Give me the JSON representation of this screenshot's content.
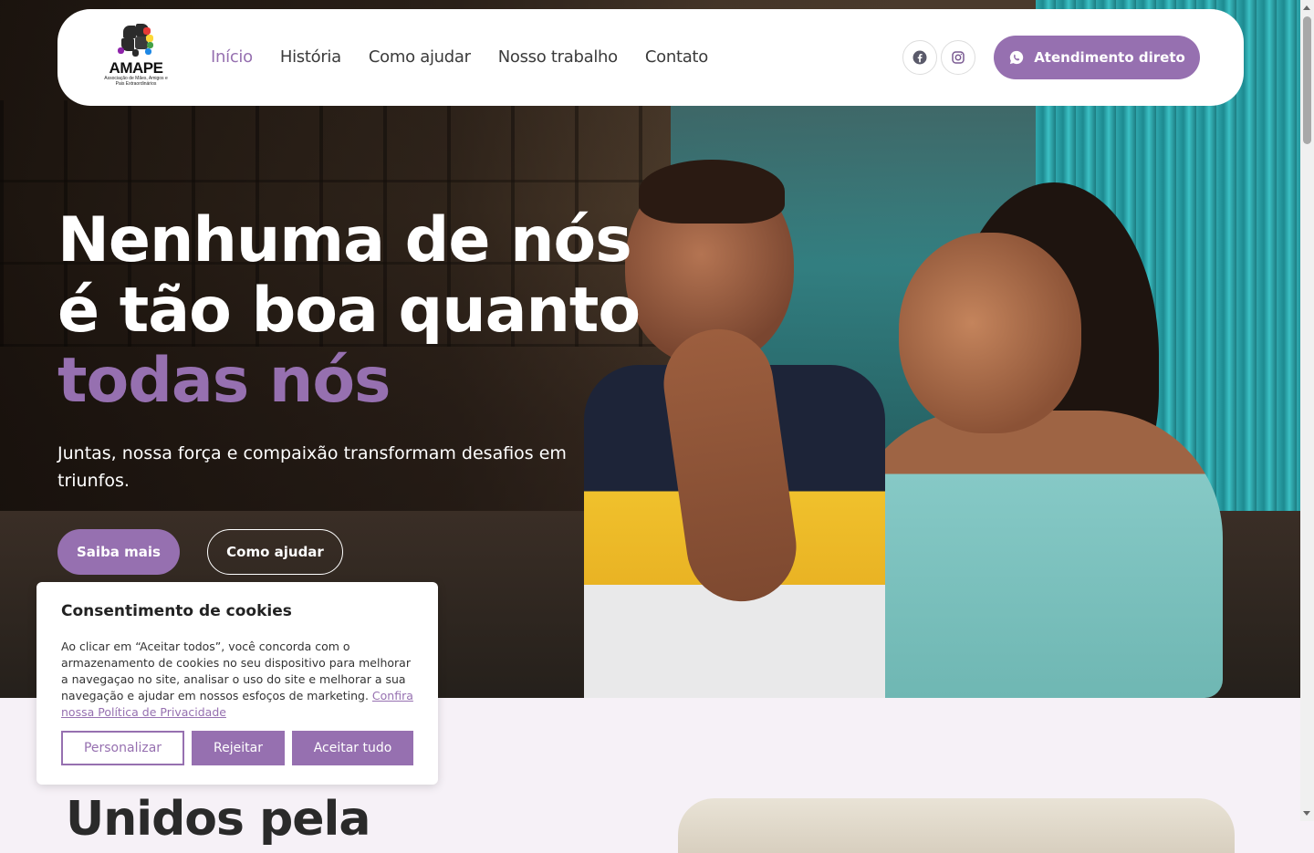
{
  "nav": {
    "logo_name": "AMAPE",
    "logo_tagline": "Associação de Mães, Amigos e Pais Extraordinários",
    "items": [
      {
        "label": "Início",
        "active": true
      },
      {
        "label": "História",
        "active": false
      },
      {
        "label": "Como ajudar",
        "active": false
      },
      {
        "label": "Nosso trabalho",
        "active": false
      },
      {
        "label": "Contato",
        "active": false
      }
    ],
    "social": [
      "facebook-icon",
      "instagram-icon"
    ],
    "cta_label": "Atendimento direto",
    "cta_icon": "whatsapp-icon"
  },
  "hero": {
    "headline_line1": "Nenhuma de nós",
    "headline_line2": "é tão boa quanto",
    "headline_accent": "todas nós",
    "subtitle": "Juntas, nossa força e compaixão transformam desafios em triunfos.",
    "primary_button": "Saiba mais",
    "secondary_button": "Como ajudar"
  },
  "lower": {
    "heading": "Unidos pela"
  },
  "cookie": {
    "title": "Consentimento de cookies",
    "body": " Ao clicar em “Aceitar todos”, você concorda com o armazenamento de cookies no seu dispositivo para melhorar a navegaçao no site, analisar o uso do site e melhorar a sua navegação e ajudar em nossos esfoços de marketing. ",
    "link": "Confira nossa Política de Privacidade",
    "customize": "Personalizar",
    "reject": "Rejeitar",
    "accept": "Aceitar tudo"
  },
  "colors": {
    "accent": "#9670b0",
    "white": "#ffffff",
    "text_dark": "#3b3b3b"
  }
}
